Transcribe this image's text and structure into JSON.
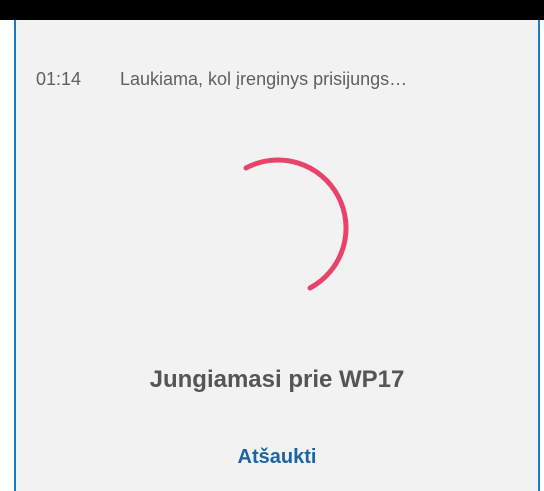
{
  "status": {
    "elapsed_time": "01:14",
    "message": "Laukiama, kol įrenginys prisijungs…"
  },
  "connection": {
    "title": "Jungiamasi prie WP17"
  },
  "actions": {
    "cancel_label": "Atšaukti"
  },
  "colors": {
    "spinner": "#e8436b",
    "accent": "#1a64a4",
    "border": "#1a7ac8",
    "background": "#f2f2f2"
  },
  "icons": {
    "spinner": "loading-spinner-icon"
  }
}
